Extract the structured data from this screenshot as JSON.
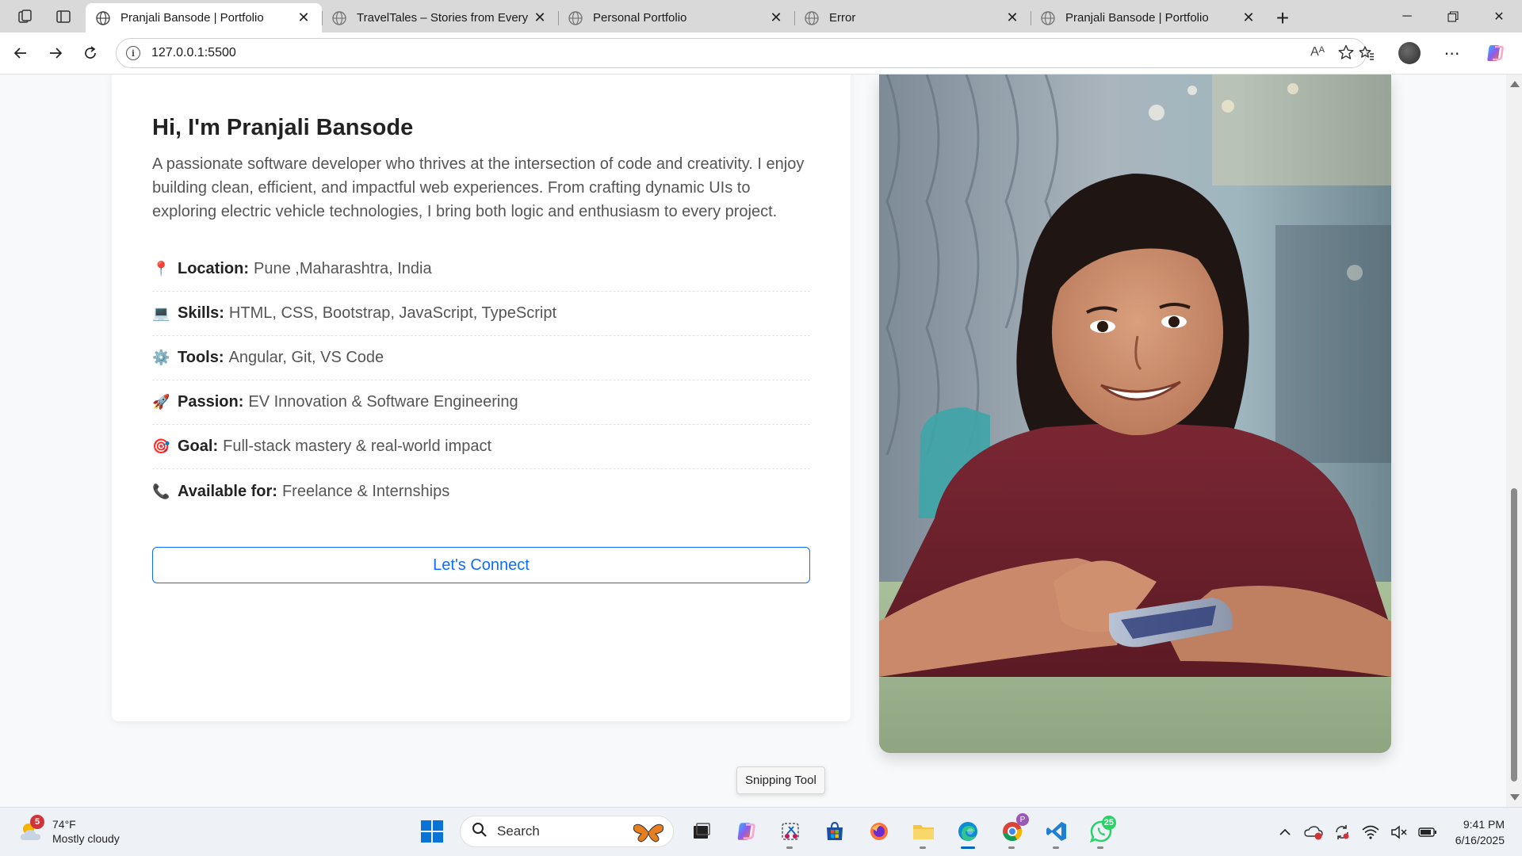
{
  "browser": {
    "tabs": [
      {
        "title": "Pranjali Bansode | Portfolio",
        "active": true
      },
      {
        "title": "TravelTales – Stories from Every Co",
        "active": false
      },
      {
        "title": "Personal Portfolio",
        "active": false
      },
      {
        "title": "Error",
        "active": false
      },
      {
        "title": "Pranjali Bansode | Portfolio",
        "active": false
      }
    ],
    "url": "127.0.0.1:5500",
    "read_aloud_glyph": "Aᴬ"
  },
  "page": {
    "heading": "Hi, I'm Pranjali Bansode",
    "bio": "A passionate software developer who thrives at the intersection of code and creativity. I enjoy building clean, efficient, and impactful web experiences. From crafting dynamic UIs to exploring electric vehicle technologies, I bring both logic and enthusiasm to every project.",
    "facts": [
      {
        "emoji": "📍",
        "label": "Location:",
        "value": "Pune ,Maharashtra, India"
      },
      {
        "emoji": "💻",
        "label": "Skills:",
        "value": "HTML, CSS, Bootstrap, JavaScript, TypeScript"
      },
      {
        "emoji": "⚙️",
        "label": "Tools:",
        "value": "Angular, Git, VS Code"
      },
      {
        "emoji": "🚀",
        "label": "Passion:",
        "value": "EV Innovation & Software Engineering"
      },
      {
        "emoji": "🎯",
        "label": "Goal:",
        "value": "Full-stack mastery & real-world impact"
      },
      {
        "emoji": "📞",
        "label": "Available for:",
        "value": "Freelance & Internships"
      }
    ],
    "connect_label": "Let's Connect",
    "accent_color": "#0d6efd"
  },
  "tooltip": "Snipping Tool",
  "taskbar": {
    "weather": {
      "badge": "5",
      "temp": "74°F",
      "condition": "Mostly cloudy"
    },
    "search_placeholder": "Search",
    "whatsapp_badge": "25",
    "time": "9:41 PM",
    "date": "6/16/2025"
  }
}
